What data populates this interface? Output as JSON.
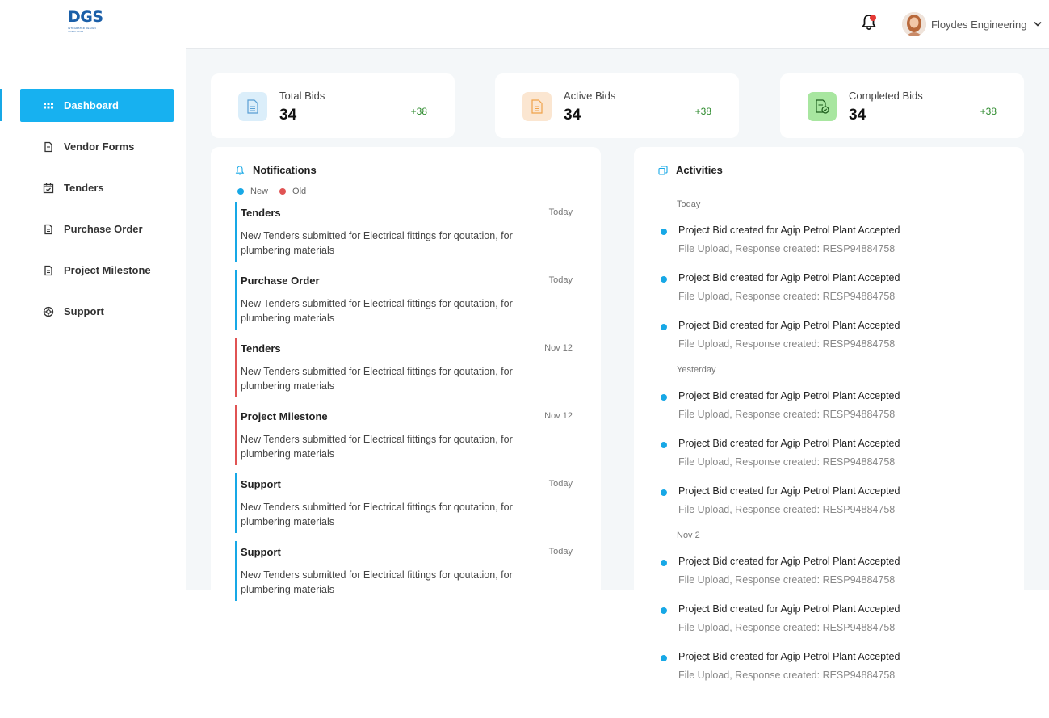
{
  "brand": {
    "logo_text": "DGS",
    "logo_tagline": "INTEGRATED DESIGN SOLUTIONS"
  },
  "header": {
    "user_name": "Floydes Engineering",
    "notification_dot_color": "#e53935"
  },
  "sidebar": {
    "items": [
      {
        "label": "Dashboard",
        "icon": "grid-icon",
        "active": true
      },
      {
        "label": "Vendor Forms",
        "icon": "document-icon"
      },
      {
        "label": "Tenders",
        "icon": "calendar-check-icon"
      },
      {
        "label": "Purchase Order",
        "icon": "document-icon"
      },
      {
        "label": "Project Milestone",
        "icon": "document-icon"
      },
      {
        "label": "Support",
        "icon": "lifebuoy-icon"
      }
    ]
  },
  "stats": [
    {
      "label": "Total Bids",
      "value": "34",
      "delta": "+38",
      "icon": "document-icon",
      "accent": "#dbeefa"
    },
    {
      "label": "Active Bids",
      "value": "34",
      "delta": "+38",
      "icon": "document-icon",
      "accent": "#fbe6d1"
    },
    {
      "label": "Completed Bids",
      "value": "34",
      "delta": "+38",
      "icon": "checked-document-icon",
      "accent": "#a8e6a0"
    }
  ],
  "notifications": {
    "title": "Notifications",
    "legend": {
      "new_label": "New",
      "old_label": "Old",
      "new_color": "#17a8e6",
      "old_color": "#e05353"
    },
    "items": [
      {
        "title": "Tenders",
        "date": "Today",
        "body": "New Tenders submitted for Electrical fittings for qoutation, for plumbering materials",
        "status": "new"
      },
      {
        "title": "Purchase Order",
        "date": "Today",
        "body": "New Tenders submitted for Electrical fittings for qoutation, for plumbering materials",
        "status": "new"
      },
      {
        "title": "Tenders",
        "date": "Nov 12",
        "body": "New Tenders submitted for Electrical fittings for qoutation, for plumbering materials",
        "status": "old"
      },
      {
        "title": "Project Milestone",
        "date": "Nov 12",
        "body": "New Tenders submitted for Electrical fittings for qoutation, for plumbering materials",
        "status": "old"
      },
      {
        "title": "Support",
        "date": "Today",
        "body": "New Tenders submitted for Electrical fittings for qoutation, for plumbering materials",
        "status": "new"
      },
      {
        "title": "Support",
        "date": "Today",
        "body": "New Tenders submitted for Electrical fittings for qoutation, for plumbering materials",
        "status": "new"
      }
    ]
  },
  "activities": {
    "title": "Activities",
    "groups": [
      {
        "day": "Today",
        "items": [
          {
            "title": "Project Bid created for Agip Petrol Plant Accepted",
            "sub": "File Upload, Response created: RESP94884758"
          },
          {
            "title": "Project Bid created for Agip Petrol Plant Accepted",
            "sub": "File Upload, Response created: RESP94884758"
          },
          {
            "title": "Project Bid created for Agip Petrol Plant Accepted",
            "sub": "File Upload, Response created: RESP94884758"
          }
        ]
      },
      {
        "day": "Yesterday",
        "items": [
          {
            "title": "Project Bid created for Agip Petrol Plant Accepted",
            "sub": "File Upload, Response created: RESP94884758"
          },
          {
            "title": "Project Bid created for Agip Petrol Plant Accepted",
            "sub": "File Upload, Response created: RESP94884758"
          },
          {
            "title": "Project Bid created for Agip Petrol Plant Accepted",
            "sub": "File Upload, Response created: RESP94884758"
          }
        ]
      },
      {
        "day": "Nov 2",
        "items": [
          {
            "title": "Project Bid created for Agip Petrol Plant Accepted",
            "sub": "File Upload, Response created: RESP94884758"
          },
          {
            "title": "Project Bid created for Agip Petrol Plant Accepted",
            "sub": "File Upload, Response created: RESP94884758"
          },
          {
            "title": "Project Bid created for Agip Petrol Plant Accepted",
            "sub": "File Upload, Response created: RESP94884758"
          }
        ]
      }
    ]
  }
}
